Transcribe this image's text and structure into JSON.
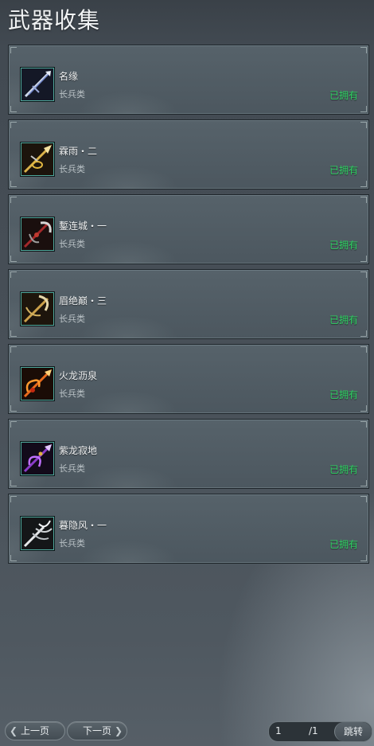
{
  "header": {
    "title": "武器收集"
  },
  "weapons": [
    {
      "name": "名缘",
      "type": "长兵类",
      "status": "已拥有",
      "icon": "silver-blue-spear-icon"
    },
    {
      "name": "霖雨・二",
      "type": "长兵类",
      "status": "已拥有",
      "icon": "golden-halberd-icon"
    },
    {
      "name": "鏨连城・一",
      "type": "长兵类",
      "status": "已拥有",
      "icon": "red-crescent-glaive-icon"
    },
    {
      "name": "眉绝巅・三",
      "type": "长兵类",
      "status": "已拥有",
      "icon": "golden-curved-glaive-icon"
    },
    {
      "name": "火龙沥泉",
      "type": "长兵类",
      "status": "已拥有",
      "icon": "fire-dragon-spear-icon"
    },
    {
      "name": "紫龙寂地",
      "type": "长兵类",
      "status": "已拥有",
      "icon": "purple-dragon-spear-icon"
    },
    {
      "name": "暮隐风・一",
      "type": "长兵类",
      "status": "已拥有",
      "icon": "silver-trident-icon"
    }
  ],
  "pager": {
    "prev_label": "上一页",
    "next_label": "下一页",
    "current_page": "1",
    "total_pages": "/1",
    "jump_label": "跳转"
  },
  "colors": {
    "owned_status": "#2ed262",
    "icon_border": "#4fa89c"
  }
}
